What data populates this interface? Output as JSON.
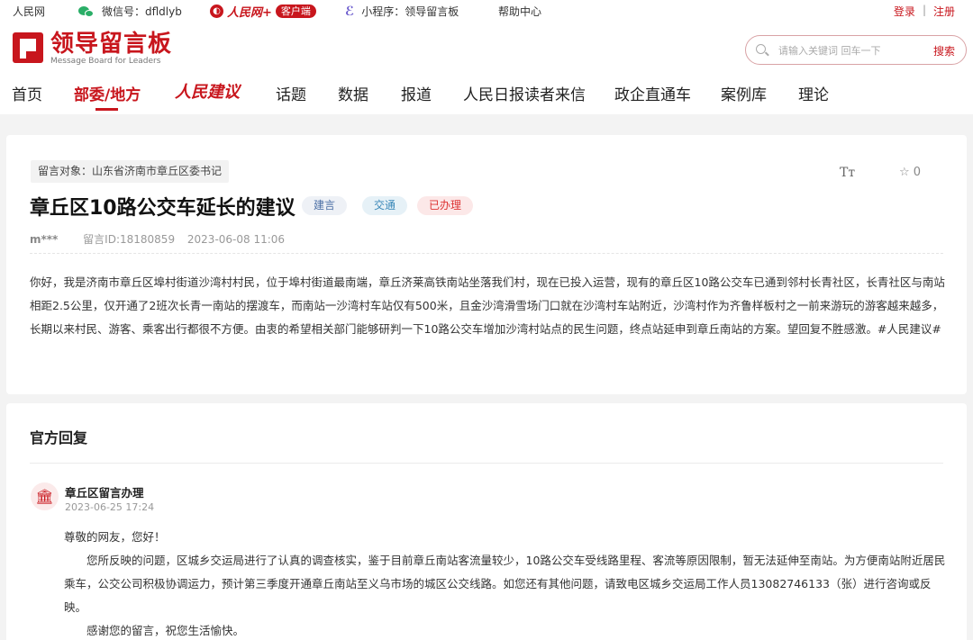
{
  "topbar": {
    "site": "人民网",
    "wechat": "微信号：dfldlyb",
    "rmw_logo_text": "人民网+",
    "rmw_badge": "客户端",
    "miniprogram": "小程序：领导留言板",
    "help": "帮助中心",
    "login": "登录",
    "separator": "|",
    "register": "注册"
  },
  "header": {
    "logo_title": "领导留言板",
    "logo_subtitle": "Message Board for Leaders",
    "search_placeholder": "请输入关键词 回车一下",
    "search_button": "搜索"
  },
  "nav": {
    "home": "首页",
    "ministries": "部委/地方",
    "brand_suggest": "人民建议",
    "topics": "话题",
    "data": "数据",
    "reports": "报道",
    "letters": "人民日报读者来信",
    "enterprise": "政企直通车",
    "cases": "案例库",
    "theory": "理论"
  },
  "message": {
    "target": "留言对象：山东省济南市章丘区委书记",
    "font_toggle": "Tт",
    "star_count": "☆ 0",
    "title": "章丘区10路公交车延长的建议",
    "tags": [
      "建言",
      "交通",
      "已办理"
    ],
    "author": "m***",
    "message_id": "留言ID:18180859",
    "date": "2023-06-08 11:06",
    "content": "你好，我是济南市章丘区埠村街道沙湾村村民，位于埠村街道最南端，章丘济莱高铁南站坐落我们村，现在已投入运营，现有的章丘区10路公交车已通到邻村长青社区，长青社区与南站相距2.5公里，仅开通了2班次长青一南站的摆渡车，而南站一沙湾村车站仅有500米，且金沙湾滑雪场门口就在沙湾村车站附近，沙湾村作为齐鲁样板村之一前来游玩的游客越来越多，长期以来村民、游客、乘客出行都很不方便。由衷的希望相关部门能够研判一下10路公交车增加沙湾村站点的民生问题，终点站延申到章丘南站的方案。望回复不胜感激。#人民建议#"
  },
  "reply": {
    "heading": "官方回复",
    "org": "章丘区留言办理",
    "time": "2023-06-25 17:24",
    "greeting": "尊敬的网友，您好！",
    "body": "您所反映的问题，区城乡交运局进行了认真的调查核实，鉴于目前章丘南站客流量较少，10路公交车受线路里程、客流等原因限制，暂无法延伸至南站。为方便南站附近居民乘车，公交公司积极协调运力，预计第三季度开通章丘南站至义乌市场的城区公交线路。如您还有其他问题，请致电区城乡交运局工作人员13082746133（张）进行咨询或反映。",
    "closing": "感谢您的留言，祝您生活愉快。"
  },
  "colors": {
    "brand_red": "#c8161d",
    "wechat_green": "#2aae67"
  }
}
